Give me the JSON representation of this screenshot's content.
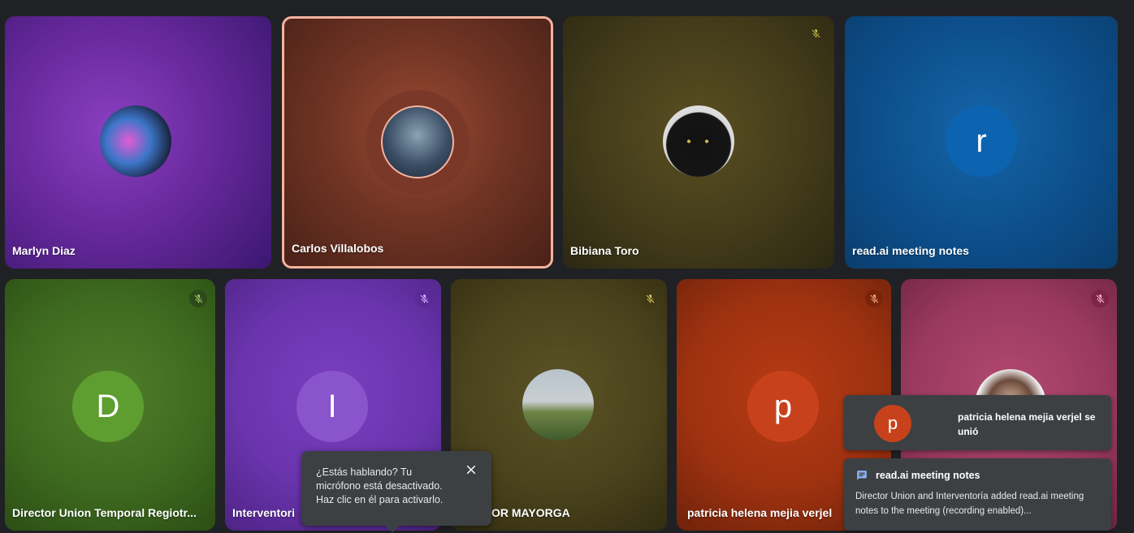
{
  "participants": {
    "marlyn": {
      "name": "Marlyn Diaz"
    },
    "carlos": {
      "name": "Carlos Villalobos"
    },
    "bibiana": {
      "name": "Bibiana Toro"
    },
    "readai": {
      "name": "read.ai meeting notes",
      "initial": "r"
    },
    "director": {
      "name": "Director Union Temporal Regiotr...",
      "initial": "D"
    },
    "interventoria": {
      "name": "Interventori",
      "initial": "I"
    },
    "mayorga": {
      "name": "OR MAYORGA"
    },
    "patricia": {
      "name": "patricia helena mejia verjel",
      "initial": "p"
    },
    "pink": {
      "name": ""
    }
  },
  "tooltip": {
    "text": "¿Estás hablando? Tu micrófono está desactivado. Haz clic en él para activarlo."
  },
  "notifications": {
    "join": {
      "initial": "p",
      "text": "patricia helena mejia verjel se unió"
    },
    "readai": {
      "title": "read.ai meeting notes",
      "body": "Director Union and Interventoría added read.ai meeting notes to the meeting (recording enabled)..."
    }
  },
  "icons": {
    "mute": "mic-off-icon",
    "close": "close-icon",
    "chat": "message-icon"
  },
  "colors": {
    "speaking_border": "#f4b29d",
    "toast_bg": "#3c4043"
  }
}
